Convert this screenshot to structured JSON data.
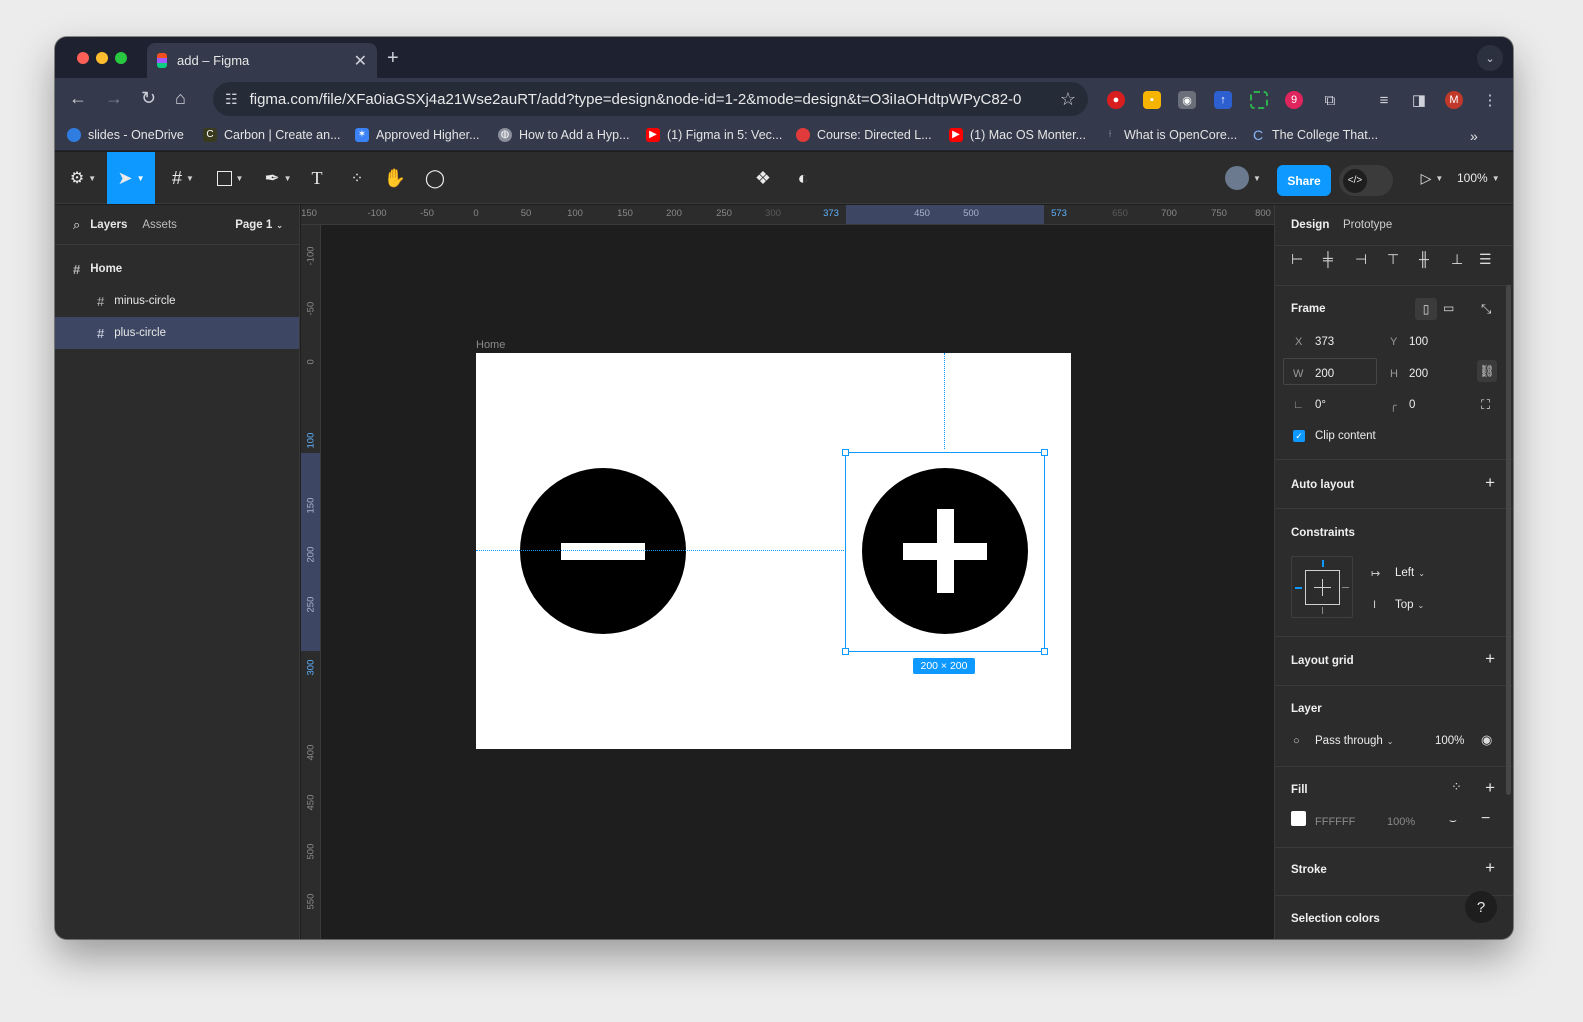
{
  "browser": {
    "tab_title": "add – Figma",
    "url": "figma.com/file/XFa0iaGSXj4a21Wse2auRT/add?type=design&node-id=1-2&mode=design&t=O3iIaOHdtpWPyC82-0",
    "bookmarks": [
      {
        "label": "slides - OneDrive",
        "icon": "onedrive-icon",
        "color": "#2f7de1"
      },
      {
        "label": "Carbon | Create an...",
        "icon": "carbon-icon",
        "color": "#3a3a1f"
      },
      {
        "label": "Approved Higher...",
        "icon": "star-badge-icon",
        "color": "#3b82f6"
      },
      {
        "label": "How to Add a Hyp...",
        "icon": "globe-icon",
        "color": "#8a8f9c"
      },
      {
        "label": "(1) Figma in 5: Vec...",
        "icon": "youtube-icon",
        "color": "#ff0000"
      },
      {
        "label": "Course: Directed L...",
        "icon": "course-icon",
        "color": "#e03a3a"
      },
      {
        "label": "(1) Mac OS Monter...",
        "icon": "youtube-icon",
        "color": "#ff0000"
      },
      {
        "label": "What is OpenCore...",
        "icon": "opencore-icon",
        "color": "#8a8f9c"
      },
      {
        "label": "The College That...",
        "icon": "college-icon",
        "color": "#2c5ea8"
      }
    ],
    "profile_initial": "M",
    "extension_badge": "9"
  },
  "toolbar": {
    "share_label": "Share",
    "zoom": "100%"
  },
  "left_panel": {
    "tabs": [
      "Layers",
      "Assets"
    ],
    "page": "Page 1",
    "layers": [
      {
        "name": "Home",
        "level": 0,
        "selected": false
      },
      {
        "name": "minus-circle",
        "level": 1,
        "selected": false
      },
      {
        "name": "plus-circle",
        "level": 1,
        "selected": true
      }
    ]
  },
  "rulers": {
    "horizontal": [
      "150",
      "-100",
      "-50",
      "0",
      "50",
      "100",
      "150",
      "200",
      "250",
      "300",
      "373",
      "450",
      "500",
      "573",
      "650",
      "700",
      "750",
      "800"
    ],
    "vertical": [
      "-100",
      "-50",
      "0",
      "100",
      "150",
      "200",
      "250",
      "300",
      "400",
      "450",
      "500",
      "550"
    ]
  },
  "canvas": {
    "frame_label": "Home",
    "selection_size": "200 × 200"
  },
  "right_panel": {
    "tabs": [
      "Design",
      "Prototype"
    ],
    "frame": {
      "title": "Frame",
      "x_label": "X",
      "x": "373",
      "y_label": "Y",
      "y": "100",
      "w_label": "W",
      "w": "200",
      "h_label": "H",
      "h": "200",
      "rotation": "0°",
      "radius": "0",
      "clip_content": "Clip content"
    },
    "auto_layout": "Auto layout",
    "constraints": {
      "title": "Constraints",
      "horizontal": "Left",
      "vertical": "Top"
    },
    "layout_grid": "Layout grid",
    "layer": {
      "title": "Layer",
      "blend": "Pass through",
      "opacity": "100%"
    },
    "fill": {
      "title": "Fill",
      "hex": "FFFFFF",
      "opacity": "100%",
      "color": "#FFFFFF"
    },
    "stroke": "Stroke",
    "selection_colors": "Selection colors"
  },
  "colors": {
    "accent": "#0d99ff",
    "panel": "#2c2c2c",
    "canvas": "#1e1e1e"
  }
}
